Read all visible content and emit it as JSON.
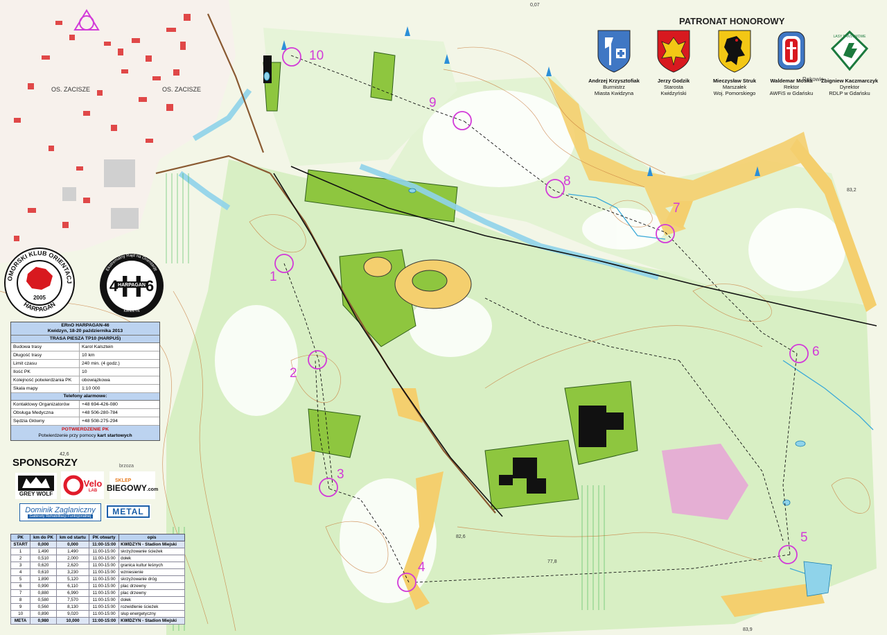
{
  "colors": {
    "control": "#d23bd8",
    "forest_light": "#d9f0c4",
    "forest_green": "#9acd32",
    "open_yellow": "#f5d27a",
    "water": "#9fd8ea",
    "contour": "#c87a3a"
  },
  "map_labels": {
    "os_zacisze_1": "OS. ZACISZE",
    "os_zacisze_2": "OS. ZACISZE",
    "brzoza": "brzoza",
    "rakowiec": "Rakowie",
    "spot_83_2": "83,2",
    "spot_82_6": "82,6",
    "spot_77_8": "77,8",
    "spot_83_9": "83,9",
    "spot_0_07": "0,07",
    "spot_42_6": "42,6"
  },
  "controls": [
    "1",
    "2",
    "3",
    "4",
    "5",
    "6",
    "7",
    "8",
    "9",
    "10"
  ],
  "club_logo": {
    "top_text": "POMORSKI KLUB ORIENTACJI",
    "year": "2005",
    "bottom_text": "HARPAGAN"
  },
  "event_logo": {
    "ring_text": "Ekstremalny Rajd na Orientację",
    "letter": "H",
    "left_num": "4",
    "right_num": "6",
    "banner": "HARPAGAN",
    "dates": "18-20.10.2013",
    "place": "KWIDZYN"
  },
  "patronage": {
    "title": "PATRONAT HONOROWY",
    "patrons": [
      {
        "line1": "Andrzej Krzysztofiak",
        "line2": "Burmistrz",
        "line3": "Miasta Kwidzyna"
      },
      {
        "line1": "Jerzy Godzik",
        "line2": "Starosta",
        "line3": "Kwidzyński"
      },
      {
        "line1": "Mieczysław Struk",
        "line2": "Marszałek",
        "line3": "Woj. Pomorskiego"
      },
      {
        "line1": "Waldemar Moska",
        "line2": "Rektor",
        "line3": "AWFiS w Gdańsku"
      },
      {
        "line1": "Zbigniew Kaczmarczyk",
        "line2": "Dyrektor",
        "line3": "RDLP w Gdańsku"
      }
    ],
    "lp_text": "LASY PAŃSTWOWE"
  },
  "info": {
    "event": "ERnO HARPAGAN-46",
    "dates": "Kwidzyn, 18-20 października 2013",
    "route": "TRASA PIESZA TP10 (HARPUŚ)",
    "rows": [
      {
        "label": "Budowa trasy",
        "value": "Karol Kalsztein"
      },
      {
        "label": "Długość trasy",
        "value": "10 km"
      },
      {
        "label": "Limit czasu",
        "value": "240 min. (4 godz.)"
      },
      {
        "label": "Ilość PK",
        "value": "10"
      },
      {
        "label": "Kolejność potwierdzania PK",
        "value": "obowiązkowa"
      },
      {
        "label": "Skala mapy",
        "value": "1:10 000"
      }
    ],
    "phones_title": "Telefony alarmowe:",
    "phones": [
      {
        "label": "Kontaktowy Organizatorów",
        "value": "+48 694-426-080"
      },
      {
        "label": "Obsługa Medyczna",
        "value": "+48 506-280-784"
      },
      {
        "label": "Sędzia Główny",
        "value": "+48 508-275-294"
      }
    ],
    "confirm_title": "POTWIERDZENIE PK",
    "confirm_text_a": "Potwierdzenie przy pomocy ",
    "confirm_text_b": "kart startowych"
  },
  "sponsors": {
    "title": "SPONSORZY",
    "grey_wolf": "GREY WOLF",
    "velo": "Velo",
    "velo_sub": "LAB",
    "sklep_top": "SKLEP",
    "sklep_main": "BIEGOWY",
    "sklep_dom": ".com",
    "dominik": "Dominik Zaglaniczny",
    "dominik_sub": "Gabinety Rehabilitacji Funkcjonalnej",
    "metal": "METAL"
  },
  "table": {
    "headers": [
      "PK",
      "km do PK",
      "km od startu",
      "PK otwarty",
      "opis"
    ],
    "rows": [
      [
        "START",
        "0,000",
        "0,000",
        "11:00-15:00",
        "KWIDZYN - Stadion Miejski"
      ],
      [
        "1",
        "1,490",
        "1,490",
        "11:00-15:00",
        "skrzyżowanie ścieżek"
      ],
      [
        "2",
        "0,510",
        "2,000",
        "11:00-15:00",
        "dołek"
      ],
      [
        "3",
        "0,620",
        "2,620",
        "11:00-15:00",
        "granica kultur leśnych"
      ],
      [
        "4",
        "0,610",
        "3,230",
        "11:00-15:00",
        "wzniesienie"
      ],
      [
        "5",
        "1,890",
        "5,120",
        "11:00-15:00",
        "skrzyżowanie dróg"
      ],
      [
        "6",
        "0,990",
        "6,110",
        "11:00-15:00",
        "plac drzewny"
      ],
      [
        "7",
        "0,880",
        "6,990",
        "11:00-15:00",
        "plac drzewny"
      ],
      [
        "8",
        "0,580",
        "7,570",
        "11:00-15:00",
        "dołek"
      ],
      [
        "9",
        "0,560",
        "8,130",
        "11:00-15:00",
        "rozwidlenie ścieżek"
      ],
      [
        "10",
        "0,890",
        "9,020",
        "11:00-15:00",
        "słup energetyczny"
      ],
      [
        "META",
        "0,980",
        "10,000",
        "11:00-15:00",
        "KWIDZYN - Stadion Miejski"
      ]
    ]
  }
}
